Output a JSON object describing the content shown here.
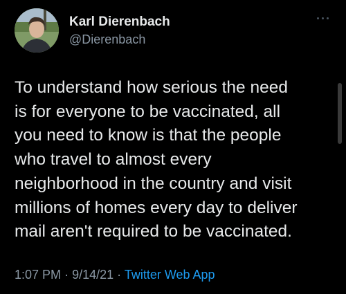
{
  "author": {
    "display_name": "Karl Dierenbach",
    "handle": "@Dierenbach"
  },
  "menu_icon": "more-horizontal-icon",
  "tweet": {
    "lines": [
      "To understand how serious the need",
      "is for everyone to be vaccinated, all",
      "you need to know is that the people",
      "who travel to almost every",
      "neighborhood in the country and visit",
      "millions of homes every day to deliver",
      "mail aren't required to be vaccinated."
    ]
  },
  "meta": {
    "time": "1:07 PM",
    "separator": "·",
    "date": "9/14/21",
    "source": "Twitter Web App"
  },
  "colors": {
    "background": "#000000",
    "text": "#e7e9ea",
    "secondary_text": "#8b98a5",
    "link": "#1d9bf0"
  }
}
